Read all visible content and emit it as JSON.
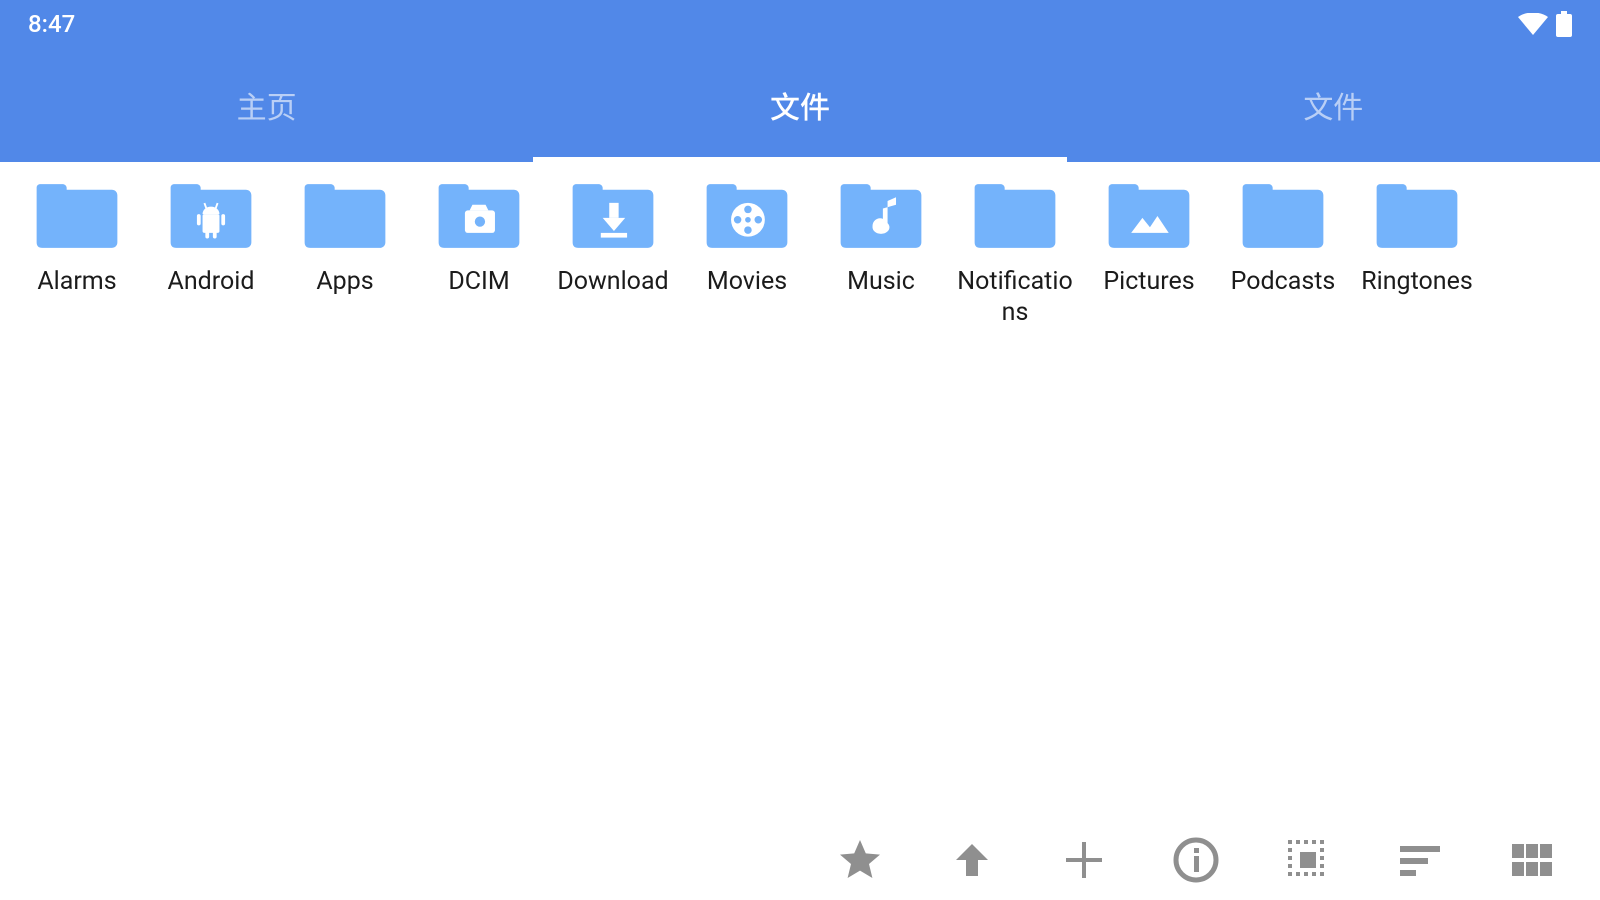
{
  "status": {
    "time": "8:47"
  },
  "tabs": [
    {
      "label": "主页",
      "active": false
    },
    {
      "label": "文件",
      "active": true
    },
    {
      "label": "文件",
      "active": false
    }
  ],
  "folders": [
    {
      "label": "Alarms",
      "icon": "plain"
    },
    {
      "label": "Android",
      "icon": "android"
    },
    {
      "label": "Apps",
      "icon": "plain"
    },
    {
      "label": "DCIM",
      "icon": "camera"
    },
    {
      "label": "Download",
      "icon": "download"
    },
    {
      "label": "Movies",
      "icon": "movie"
    },
    {
      "label": "Music",
      "icon": "music"
    },
    {
      "label": "Notifications",
      "icon": "plain"
    },
    {
      "label": "Pictures",
      "icon": "picture"
    },
    {
      "label": "Podcasts",
      "icon": "plain"
    },
    {
      "label": "Ringtones",
      "icon": "plain"
    }
  ],
  "toolbar": {
    "favorite": "favorite",
    "up": "up",
    "add": "add",
    "info": "info",
    "select_all": "select-all",
    "sort": "sort",
    "view_grid": "view-grid"
  },
  "colors": {
    "primary": "#5188e8",
    "folder": "#74b3fb",
    "toolbar_icon": "#8f8f8f"
  }
}
